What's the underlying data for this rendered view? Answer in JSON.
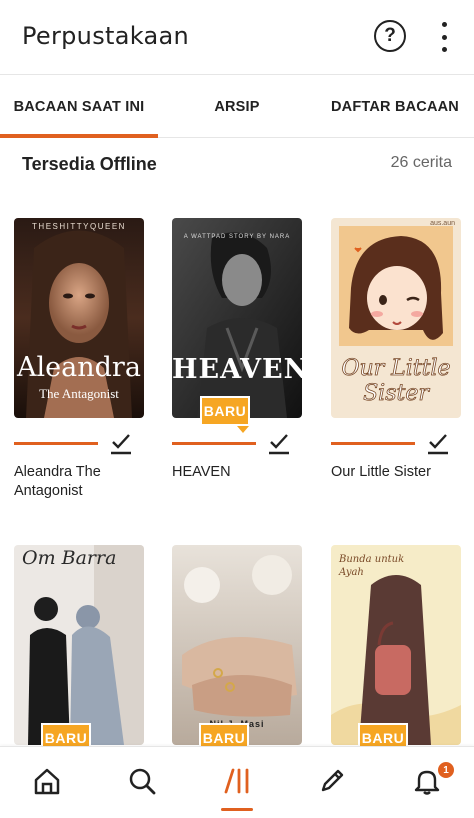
{
  "header": {
    "title": "Perpustakaan",
    "help_icon": "question-circle-icon",
    "more_icon": "vertical-dots-icon"
  },
  "tabs": [
    {
      "label": "BACAAN SAAT INI",
      "active": true
    },
    {
      "label": "ARSIP",
      "active": false
    },
    {
      "label": "DAFTAR BACAAN",
      "active": false
    }
  ],
  "section": {
    "title": "Tersedia Offline",
    "count": "26 cerita"
  },
  "books": [
    {
      "title": "Aleandra The Antagonist",
      "cover_author": "THESHITTYQUEEN",
      "cover_title": "Aleandra",
      "cover_subtitle": "The Antagonist",
      "badge": "",
      "offline": true
    },
    {
      "title": "HEAVEN",
      "cover_author": "A WATTPAD STORY BY NARA",
      "cover_title": "HEAVEN",
      "cover_subtitle": "",
      "badge": "BARU",
      "offline": true
    },
    {
      "title": "Our Little Sister",
      "cover_author": "aus.aun",
      "cover_title": "Our Little Sister",
      "cover_subtitle": "",
      "badge": "",
      "offline": true
    },
    {
      "title": "",
      "cover_author": "",
      "cover_title": "Om Barra",
      "cover_subtitle": "",
      "badge": "BARU"
    },
    {
      "title": "",
      "cover_author": "",
      "cover_title": "Nil J. Masi",
      "cover_subtitle": "",
      "badge": "BARU"
    },
    {
      "title": "",
      "cover_author": "",
      "cover_title": "Bunda untuk Ayah",
      "cover_subtitle": "",
      "badge": "BARU"
    }
  ],
  "bottom_nav": [
    {
      "icon": "home-icon",
      "active": false
    },
    {
      "icon": "search-icon",
      "active": false
    },
    {
      "icon": "library-icon",
      "active": true
    },
    {
      "icon": "pencil-icon",
      "active": false
    },
    {
      "icon": "bell-icon",
      "active": false,
      "badge": "1"
    }
  ],
  "colors": {
    "accent": "#e0601f",
    "badge": "#f6a623",
    "text": "#222222"
  }
}
